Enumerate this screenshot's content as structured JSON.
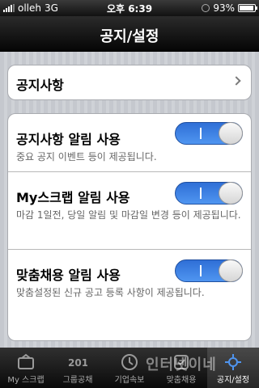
{
  "status_bar": {
    "carrier": "olleh",
    "network": "3G",
    "time": "오후 6:39",
    "battery_text": "93%",
    "battery_level": 0.93
  },
  "nav": {
    "title": "공지/설정"
  },
  "notice": {
    "label": "공지사항"
  },
  "settings": [
    {
      "label": "공지사항 알림 사용",
      "description": "중요 공지 이벤트 등이 제공됩니다.",
      "enabled": true
    },
    {
      "label": "My스크랩 알림 사용",
      "description": "마감 1일전, 당일 알림 및 마감일 변경 등이 제공됩니다.",
      "enabled": true
    },
    {
      "label": "맞춤채용 알림 사용",
      "description": "맞춤설정된 신규 공고 등록 사항이 제공됩니다.",
      "enabled": true
    }
  ],
  "tabs": [
    {
      "label": "My 스크랩",
      "icon": "scrap-icon"
    },
    {
      "label": "그룹공채",
      "icon": "group-recruit-icon"
    },
    {
      "label": "기업속보",
      "icon": "company-news-icon"
    },
    {
      "label": "맞춤채용",
      "icon": "custom-recruit-icon"
    },
    {
      "label": "공지/설정",
      "icon": "settings-icon",
      "active": true
    }
  ],
  "watermark": "인터넷이네"
}
